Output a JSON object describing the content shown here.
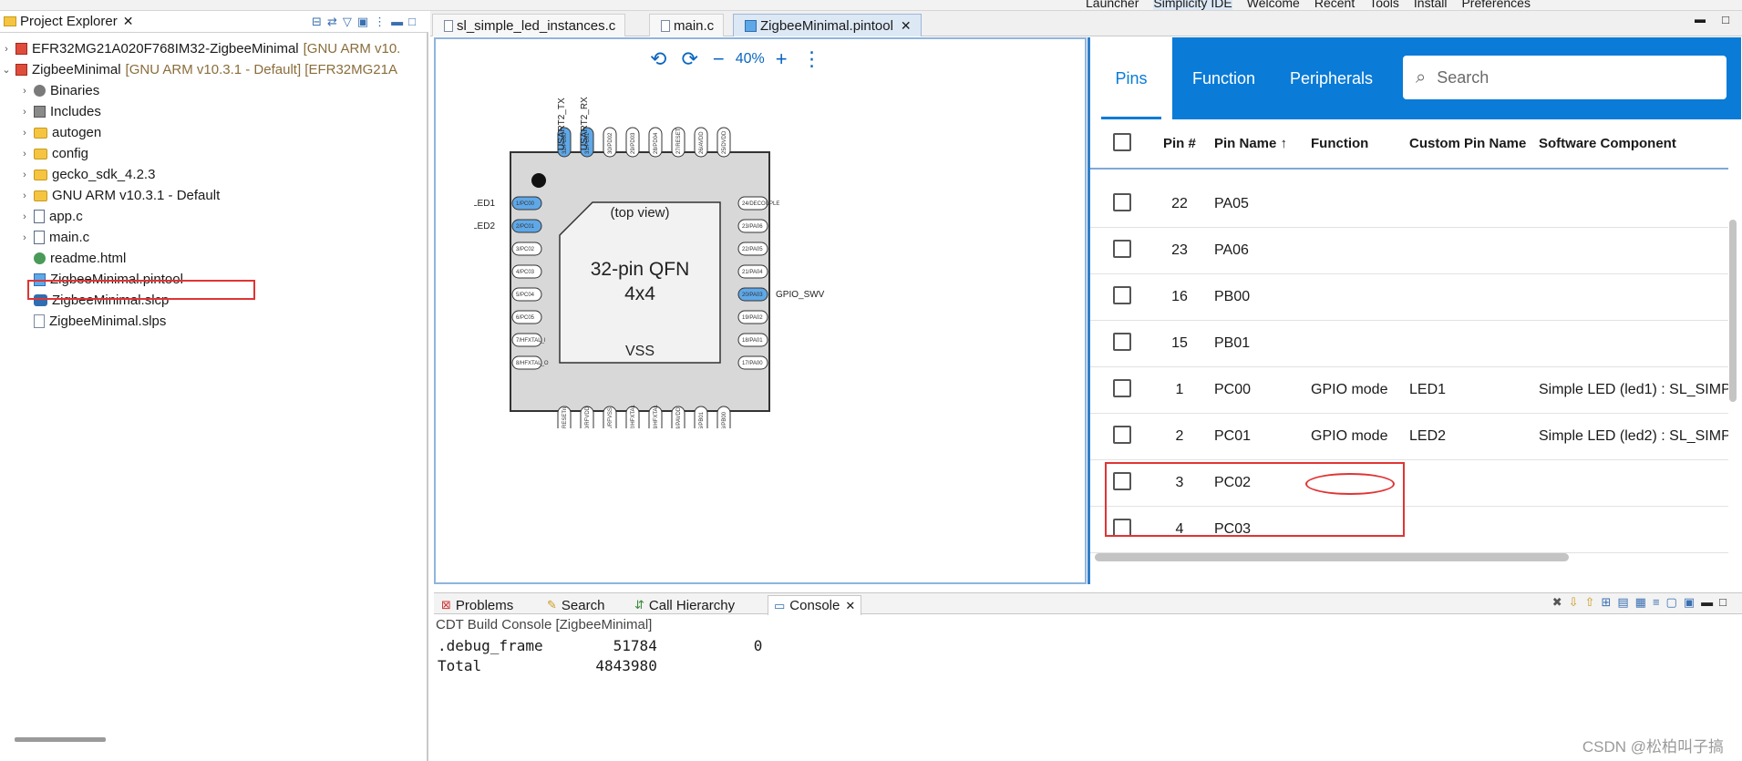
{
  "top_toolbar": {
    "items": [
      "Launcher",
      "Simplicity IDE",
      "Welcome",
      "Recent",
      "Tools",
      "Install",
      "Preferences"
    ]
  },
  "project_explorer": {
    "title": "Project Explorer",
    "tree": [
      {
        "label": "EFR32MG21A020F768IM32-ZigbeeMinimal",
        "suffix": "[GNU ARM v10.",
        "icon": "project-icon",
        "indent": 0,
        "expanded": false
      },
      {
        "label": "ZigbeeMinimal",
        "suffix": "[GNU ARM v10.3.1 - Default] [EFR32MG21A",
        "icon": "project-icon",
        "indent": 0,
        "expanded": true
      },
      {
        "label": "Binaries",
        "suffix": "",
        "icon": "binaries-icon",
        "indent": 1,
        "expanded": false
      },
      {
        "label": "Includes",
        "suffix": "",
        "icon": "includes-icon",
        "indent": 1,
        "expanded": false
      },
      {
        "label": "autogen",
        "suffix": "",
        "icon": "folder-icon",
        "indent": 1,
        "expanded": false
      },
      {
        "label": "config",
        "suffix": "",
        "icon": "folder-icon",
        "indent": 1,
        "expanded": false
      },
      {
        "label": "gecko_sdk_4.2.3",
        "suffix": "",
        "icon": "folder-icon",
        "indent": 1,
        "expanded": false
      },
      {
        "label": "GNU ARM v10.3.1 - Default",
        "suffix": "",
        "icon": "folder-icon",
        "indent": 1,
        "expanded": false
      },
      {
        "label": "app.c",
        "suffix": "",
        "icon": "c-file-icon",
        "indent": 1,
        "expanded": false
      },
      {
        "label": "main.c",
        "suffix": "",
        "icon": "c-file-icon",
        "indent": 1,
        "expanded": false
      },
      {
        "label": "readme.html",
        "suffix": "",
        "icon": "html-file-icon",
        "indent": 1,
        "expanded": null
      },
      {
        "label": "ZigbeeMinimal.pintool",
        "suffix": "",
        "icon": "pintool-file-icon",
        "indent": 1,
        "expanded": null
      },
      {
        "label": "ZigbeeMinimal.slcp",
        "suffix": "",
        "icon": "slcp-file-icon",
        "indent": 1,
        "expanded": null
      },
      {
        "label": "ZigbeeMinimal.slps",
        "suffix": "",
        "icon": "slps-file-icon",
        "indent": 1,
        "expanded": null
      }
    ]
  },
  "editor_tabs": [
    {
      "label": "sl_simple_led_instances.c",
      "active": false
    },
    {
      "label": "main.c",
      "active": false
    },
    {
      "label": "ZigbeeMinimal.pintool",
      "active": true
    }
  ],
  "pin_diagram": {
    "zoom": "40%",
    "chip_title": "32-pin QFN",
    "chip_size": "4x4",
    "view_label": "(top view)",
    "center_label": "VSS",
    "top_labels": [
      "USART2_TX",
      "USART2_RX"
    ],
    "left_labels": [
      "LED1",
      "LED2"
    ],
    "right_labels": [
      "GPIO_SWV"
    ],
    "top_pins": [
      "32/PC00",
      "31/PC01",
      "30/PD02",
      "29/PD03",
      "28/PD04",
      "27/RESET",
      "26/AVDD",
      "25/DVDD"
    ],
    "left_pins": [
      "1/PC00",
      "2/PC01",
      "3/PC02",
      "4/PC03",
      "5/PC04",
      "6/PC05",
      "7/HFXTAL_I",
      "8/HFXTAL_O"
    ],
    "right_pins": [
      "24/DECOUPLE",
      "23/PA06",
      "22/PA05",
      "21/PA04",
      "20/PA03",
      "19/PA02",
      "18/PA01",
      "17/PA00"
    ],
    "bottom_pins": [
      "9/RESETn",
      "10/RFVDD",
      "11/RFVSS",
      "12/HFXTAL",
      "13/HFXTAL",
      "14/PAVDD",
      "15/PB01",
      "16/PB00"
    ],
    "highlight_pins": [
      "32/PC00",
      "31/PC01",
      "1/PC00",
      "2/PC01",
      "20/PA03"
    ]
  },
  "pins_panel": {
    "tabs": [
      "Pins",
      "Function",
      "Peripherals"
    ],
    "active_tab": "Pins",
    "search_placeholder": "Search",
    "columns": [
      "Pin #",
      "Pin Name",
      "Function",
      "Custom Pin Name",
      "Software Component"
    ],
    "sort_indicator": "↑",
    "rows": [
      {
        "pin": "22",
        "name": "PA05",
        "function": "",
        "custom": "",
        "component": ""
      },
      {
        "pin": "23",
        "name": "PA06",
        "function": "",
        "custom": "",
        "component": ""
      },
      {
        "pin": "16",
        "name": "PB00",
        "function": "",
        "custom": "",
        "component": ""
      },
      {
        "pin": "15",
        "name": "PB01",
        "function": "",
        "custom": "",
        "component": ""
      },
      {
        "pin": "1",
        "name": "PC00",
        "function": "GPIO mode",
        "custom": "LED1",
        "component": "Simple LED (led1) : SL_SIMP"
      },
      {
        "pin": "2",
        "name": "PC01",
        "function": "GPIO mode",
        "custom": "LED2",
        "component": "Simple LED (led2) : SL_SIMP"
      },
      {
        "pin": "3",
        "name": "PC02",
        "function": "",
        "custom": "",
        "component": ""
      },
      {
        "pin": "4",
        "name": "PC03",
        "function": "",
        "custom": "",
        "component": ""
      }
    ]
  },
  "bottom_tabs": [
    {
      "label": "Problems",
      "active": false
    },
    {
      "label": "Search",
      "active": false
    },
    {
      "label": "Call Hierarchy",
      "active": false
    },
    {
      "label": "Console",
      "active": true
    }
  ],
  "console": {
    "title": "CDT Build Console [ZigbeeMinimal]",
    "lines": [
      ".debug_frame        51784           0",
      "Total             4843980"
    ]
  },
  "watermark": "CSDN @松柏叫子搞",
  "colors": {
    "accent": "#0a7bd6",
    "annotation_red": "#e03434",
    "pin_highlight": "#5fa8e8"
  }
}
